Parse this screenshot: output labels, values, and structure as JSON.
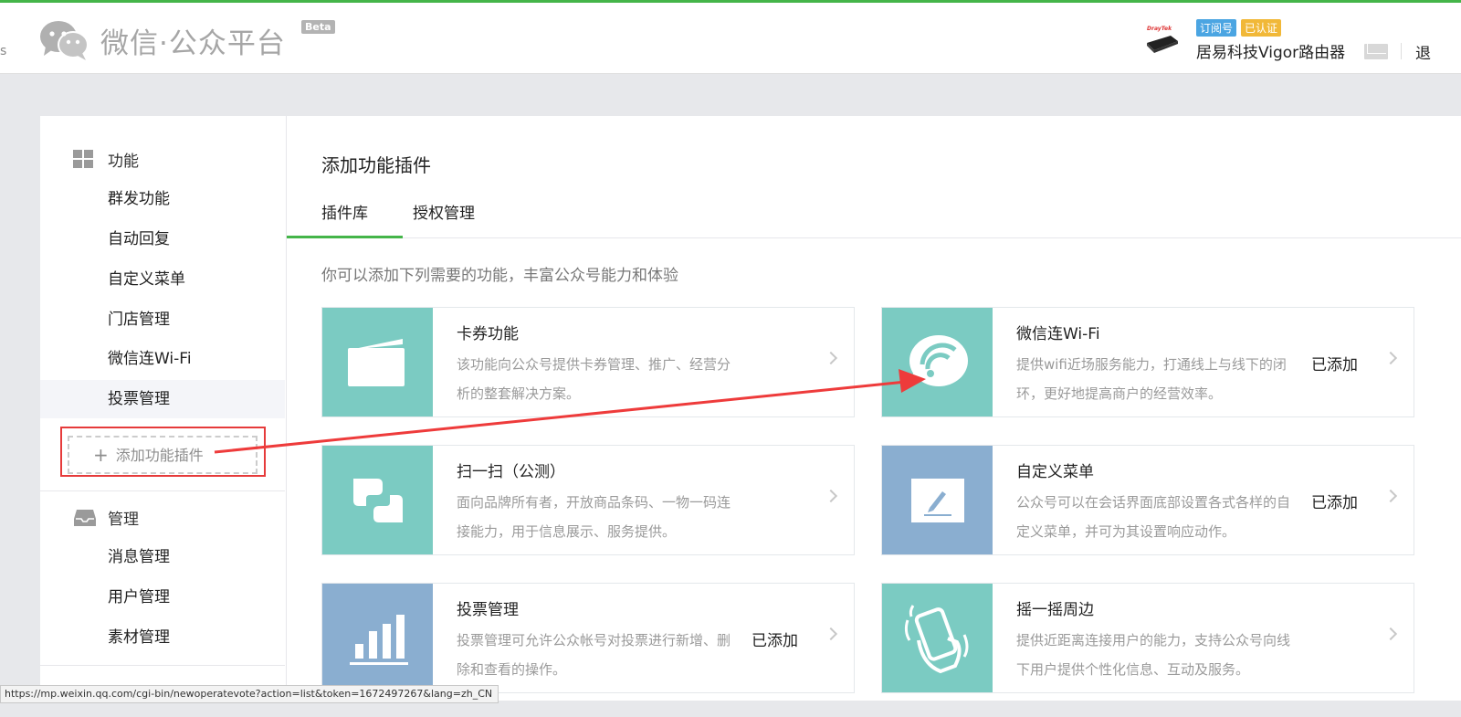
{
  "header": {
    "logo_text": "微信·公众平台",
    "beta": "Beta",
    "left_clip": "s",
    "account": {
      "badge_subscription": "订阅号",
      "badge_verified": "已认证",
      "name": "居易科技Vigor路由器",
      "avatar_brand": "DrayTek"
    },
    "exit_label": "退"
  },
  "sidebar": {
    "function_title": "功能",
    "function_items": [
      "群发功能",
      "自动回复",
      "自定义菜单",
      "门店管理",
      "微信连Wi-Fi",
      "投票管理"
    ],
    "add_plugin": "添加功能插件",
    "manage_title": "管理",
    "manage_items": [
      "消息管理",
      "用户管理",
      "素材管理"
    ]
  },
  "main": {
    "title": "添加功能插件",
    "tabs": [
      {
        "label": "插件库",
        "active": true
      },
      {
        "label": "授权管理",
        "active": false
      }
    ],
    "description": "你可以添加下列需要的功能，丰富公众号能力和体验",
    "cards": [
      {
        "name": "卡券功能",
        "text": "该功能向公众号提供卡券管理、推广、经营分析的整套解决方案。",
        "status": "",
        "icon": "card-icon",
        "color": "#7bcbc2"
      },
      {
        "name": "微信连Wi-Fi",
        "text": "提供wifi近场服务能力，打通线上与线下的闭环，更好地提高商户的经营效率。",
        "status": "已添加",
        "icon": "wifi-icon",
        "color": "#7bcbc2"
      },
      {
        "name": "扫一扫（公测）",
        "text": "面向品牌所有者，开放商品条码、一物一码连接能力，用于信息展示、服务提供。",
        "status": "",
        "icon": "scan-icon",
        "color": "#7bcbc2"
      },
      {
        "name": "自定义菜单",
        "text": "公众号可以在会话界面底部设置各式各样的自定义菜单，并可为其设置响应动作。",
        "status": "已添加",
        "icon": "edit-icon",
        "color": "#8aaed0"
      },
      {
        "name": "投票管理",
        "text": "投票管理可允许公众帐号对投票进行新增、删除和查看的操作。",
        "status": "已添加",
        "icon": "bar-chart-icon",
        "color": "#8aaed0"
      },
      {
        "name": "摇一摇周边",
        "text": "提供近距离连接用户的能力，支持公众号向线下用户提供个性化信息、互动及服务。",
        "status": "",
        "icon": "shake-icon",
        "color": "#7bcbc2"
      }
    ]
  },
  "statusbar": {
    "url": "https://mp.weixin.qq.com/cgi-bin/newoperatevote?action=list&token=1672497267&lang=zh_CN"
  }
}
